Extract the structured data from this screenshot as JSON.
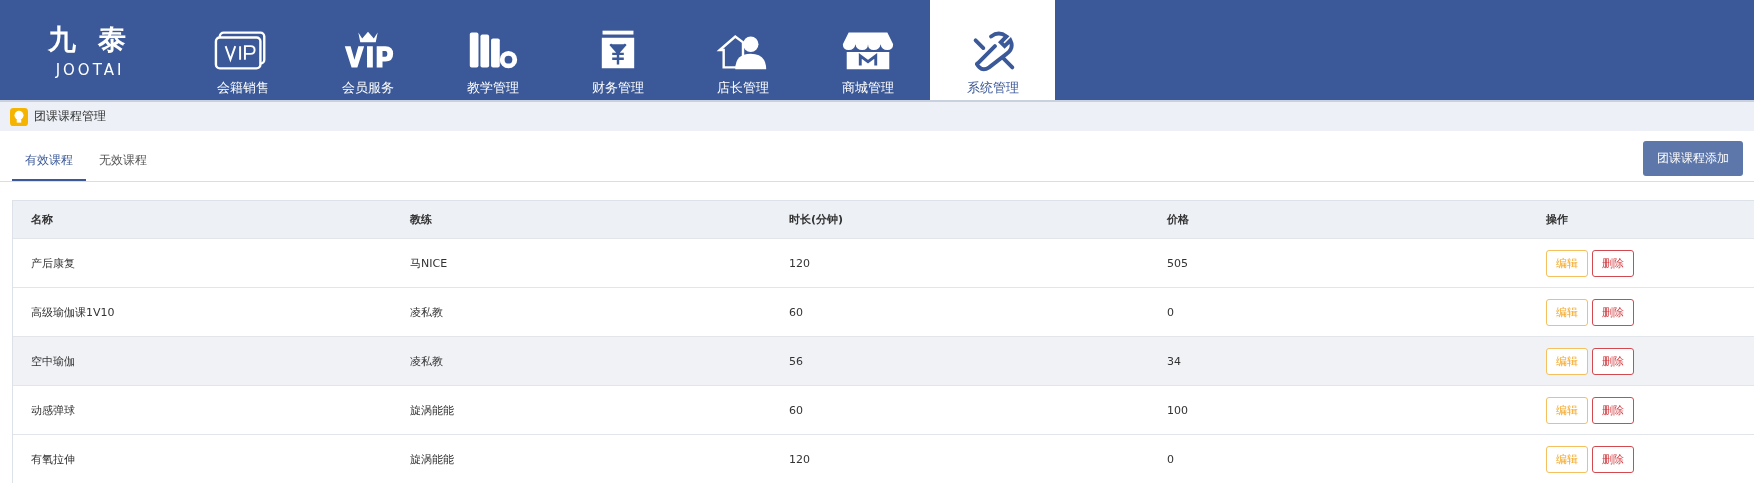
{
  "logo": {
    "mark": "九 泰",
    "name": "JOOTAI"
  },
  "nav": [
    {
      "label": "会籍销售",
      "selected": false
    },
    {
      "label": "会员服务",
      "selected": false
    },
    {
      "label": "教学管理",
      "selected": false
    },
    {
      "label": "财务管理",
      "selected": false
    },
    {
      "label": "店长管理",
      "selected": false
    },
    {
      "label": "商城管理",
      "selected": false
    },
    {
      "label": "系统管理",
      "selected": true
    }
  ],
  "breadcrumb": "团课课程管理",
  "tabs": [
    {
      "label": "有效课程",
      "selected": true
    },
    {
      "label": "无效课程",
      "selected": false
    }
  ],
  "add_button": "团课课程添加",
  "table": {
    "columns": [
      "名称",
      "教练",
      "时长(分钟)",
      "价格",
      "操作"
    ],
    "rows": [
      {
        "cells": [
          "产后康复",
          "马NICE",
          "120",
          "505"
        ],
        "actions": [
          "编辑",
          "删除"
        ],
        "highlighted": false
      },
      {
        "cells": [
          "高级瑜伽课1V10",
          "凌私教",
          "60",
          "0"
        ],
        "actions": [
          "编辑",
          "删除"
        ],
        "highlighted": false
      },
      {
        "cells": [
          "空中瑜伽",
          "凌私教",
          "56",
          "34"
        ],
        "actions": [
          "编辑",
          "删除"
        ],
        "highlighted": true
      },
      {
        "cells": [
          "动感弹球",
          "旋涡能能",
          "60",
          "100"
        ],
        "actions": [
          "编辑",
          "删除"
        ],
        "highlighted": false
      },
      {
        "cells": [
          "有氧拉伸",
          "旋涡能能",
          "120",
          "0"
        ],
        "actions": [
          "编辑",
          "删除"
        ],
        "highlighted": false
      }
    ]
  }
}
